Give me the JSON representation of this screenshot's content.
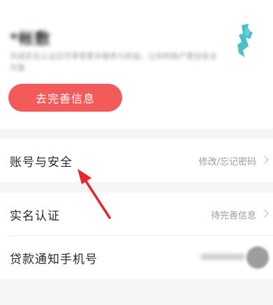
{
  "profile": {
    "name": "*帐敷",
    "description": "完成实名认证后可享受更多服务与权益，让你的账户更加安全可靠",
    "complete_button_label": "去完善信息"
  },
  "settings": {
    "account_security": {
      "label": "账号与安全",
      "value": "修改/忘记密码"
    },
    "real_name": {
      "label": "实名认证",
      "value": "待完善信息"
    },
    "loan_notify_phone": {
      "label": "贷款通知手机号"
    }
  },
  "colors": {
    "accent": "#f35a5a",
    "annotation_arrow": "#e8262a",
    "avatar": "#39b8c4"
  }
}
